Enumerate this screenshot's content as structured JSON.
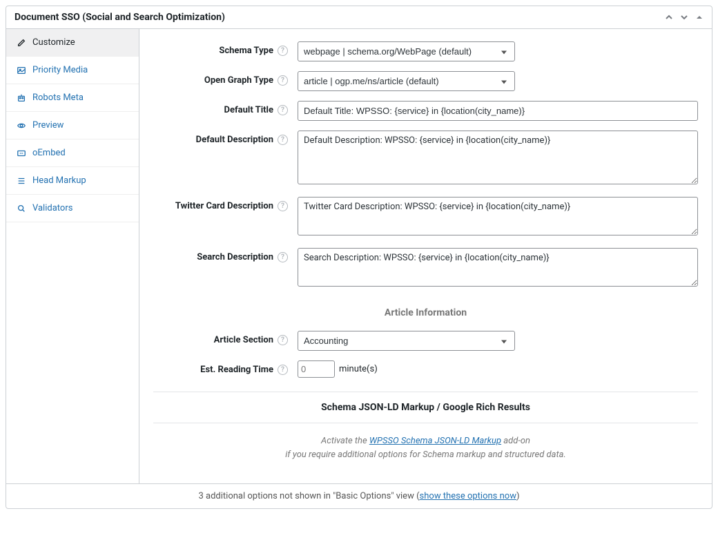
{
  "header": {
    "title": "Document SSO (Social and Search Optimization)"
  },
  "tabs": [
    {
      "id": "customize",
      "label": "Customize"
    },
    {
      "id": "priority-media",
      "label": "Priority Media"
    },
    {
      "id": "robots-meta",
      "label": "Robots Meta"
    },
    {
      "id": "preview",
      "label": "Preview"
    },
    {
      "id": "oembed",
      "label": "oEmbed"
    },
    {
      "id": "head-markup",
      "label": "Head Markup"
    },
    {
      "id": "validators",
      "label": "Validators"
    }
  ],
  "form": {
    "schema_type": {
      "label": "Schema Type",
      "value": "webpage | schema.org/WebPage (default)"
    },
    "open_graph_type": {
      "label": "Open Graph Type",
      "value": "article | ogp.me/ns/article (default)"
    },
    "default_title": {
      "label": "Default Title",
      "value": "Default Title: WPSSO: {service} in {location(city_name)}"
    },
    "default_description": {
      "label": "Default Description",
      "value": "Default Description: WPSSO: {service} in {location(city_name)}"
    },
    "twitter_description": {
      "label": "Twitter Card Description",
      "value": "Twitter Card Description: WPSSO: {service} in {location(city_name)}"
    },
    "search_description": {
      "label": "Search Description",
      "value": "Search Description: WPSSO: {service} in {location(city_name)}"
    },
    "article_info_heading": "Article Information",
    "article_section": {
      "label": "Article Section",
      "value": "Accounting"
    },
    "reading_time": {
      "label": "Est. Reading Time",
      "placeholder": "0",
      "suffix": "minute(s)"
    },
    "schema_banner": "Schema JSON-LD Markup / Google Rich Results",
    "addon_note": {
      "prefix": "Activate the ",
      "link": "WPSSO Schema JSON-LD Markup",
      "suffix": " add-on",
      "line2": "if you require additional options for Schema markup and structured data."
    }
  },
  "footer": {
    "text_prefix": "3 additional options not shown in \"Basic Options\" view (",
    "link": "show these options now",
    "text_suffix": ")"
  }
}
